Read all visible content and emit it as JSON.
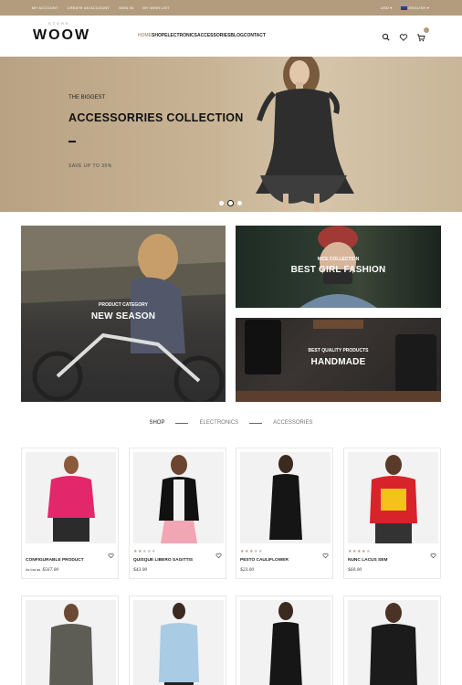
{
  "topbar": {
    "links": [
      "My Account",
      "Create an Account",
      "Sign In",
      "My Wish List"
    ],
    "currency": "USD",
    "language": "ENGLISH"
  },
  "header": {
    "logo_sub": "STORE",
    "logo": "WOOW",
    "nav": [
      "HOME",
      "SHOP",
      "ELECTRONICS",
      "ACCESSORIES",
      "BLOG",
      "CONTACT"
    ],
    "icons": [
      "search-icon",
      "heart-icon",
      "cart-icon"
    ]
  },
  "hero": {
    "pretitle": "THE BIGGEST",
    "title": "ACCESSORRIES COLLECTION",
    "subtitle": "SAVE UP TO 35%",
    "slides": 3,
    "active_slide": 2
  },
  "banners": [
    {
      "small": "PRODUCT CATEGORY",
      "big": "NEW SEASON"
    },
    {
      "small": "NICE COLLECTION",
      "big": "BEST GIRL FASHION"
    },
    {
      "small": "BEST QUALITY PRODUCTS",
      "big": "HANDMADE"
    }
  ],
  "tabs": [
    "SHOP",
    "ELECTRONICS",
    "ACCESSORIES"
  ],
  "products": [
    {
      "name": "CONFIGURABLE PRODUCT",
      "price_prefix": "As low as",
      "price": "$567.00",
      "rating": 0
    },
    {
      "name": "QUISQUE LIBERO SAGITTIS",
      "price": "$43.00",
      "rating": 2
    },
    {
      "name": "PESTO CAULIFLOWER",
      "price": "$23.00",
      "rating": 3
    },
    {
      "name": "NUNC LACUS SEM",
      "price": "$60.00",
      "rating": 4
    }
  ],
  "colors": {
    "accent": "#b39c7d",
    "topbar": "#b39c7d"
  }
}
